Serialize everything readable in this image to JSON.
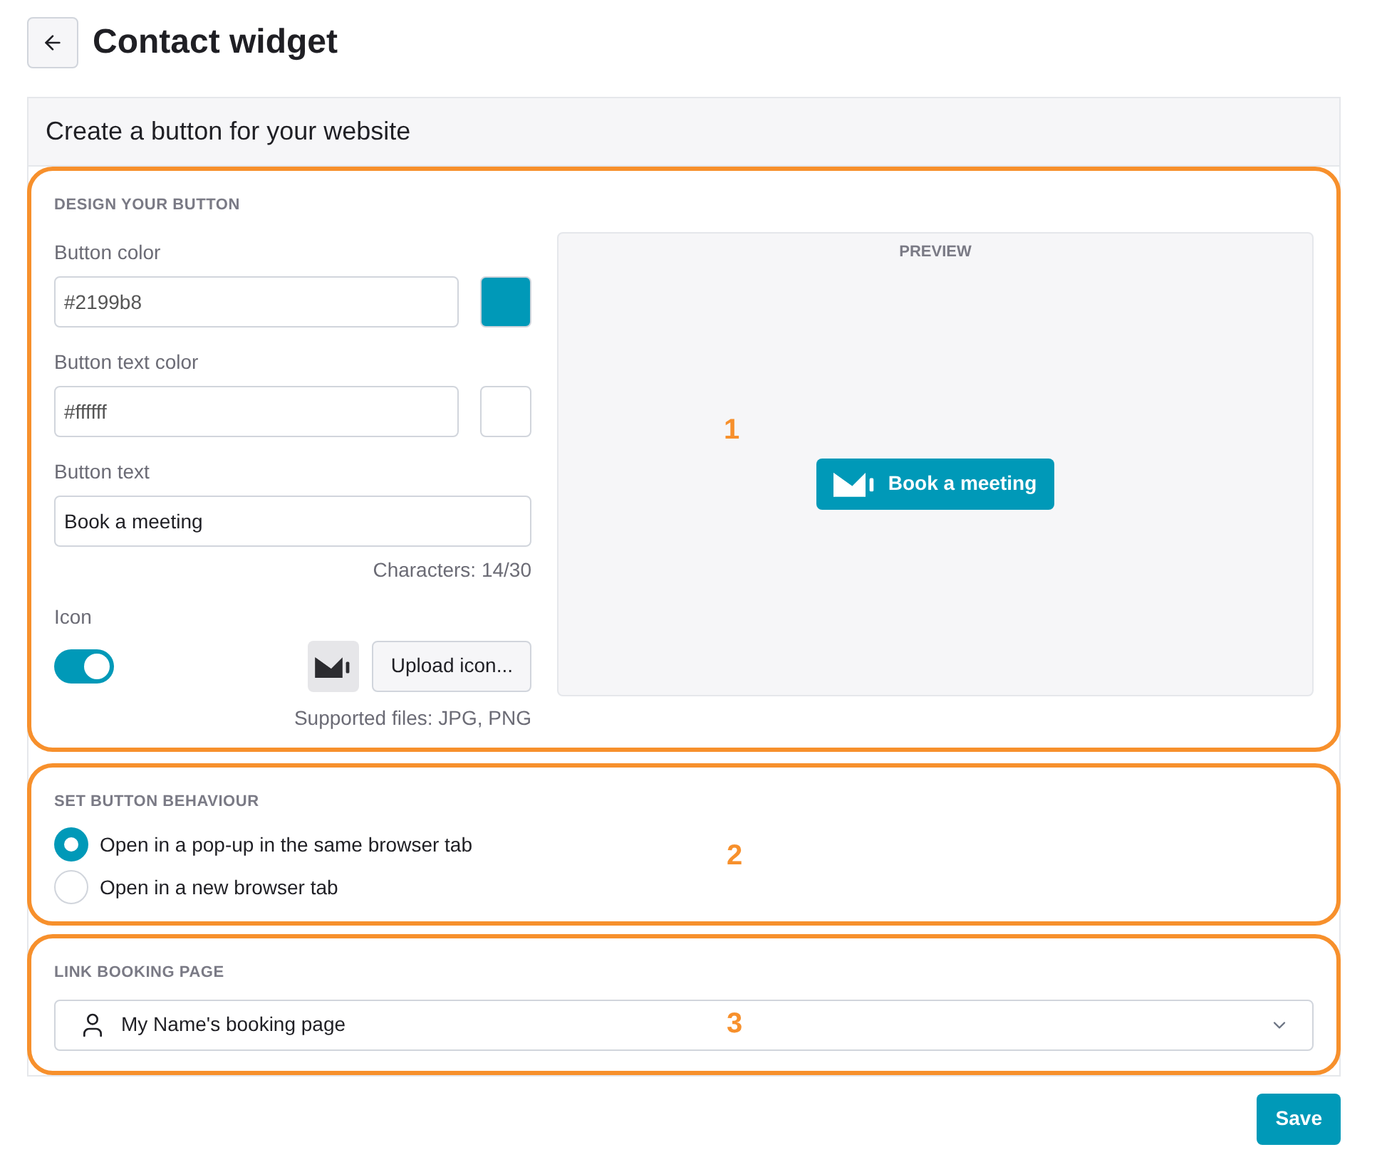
{
  "page": {
    "title": "Contact widget"
  },
  "card": {
    "title": "Create a button for your website"
  },
  "design": {
    "callout": "1",
    "heading": "DESIGN YOUR BUTTON",
    "fields": [
      {
        "kind": "color",
        "label": "Button color",
        "value": "#2199b8",
        "color": "#0099b8"
      },
      {
        "kind": "color",
        "label": "Button text color",
        "value": "#ffffff",
        "color": "#ffffff"
      },
      {
        "kind": "text",
        "label": "Button text",
        "value": "Book a meeting",
        "counter": "Characters: 14/30"
      }
    ],
    "icon": {
      "label": "Icon",
      "on": true,
      "upload": "Upload icon...",
      "note": "Supported files: JPG, PNG"
    },
    "preview": {
      "heading": "PREVIEW",
      "button": "Book a meeting"
    }
  },
  "behaviour": {
    "callout": "2",
    "heading": "SET BUTTON BEHAVIOUR",
    "options": [
      {
        "label": "Open in a pop-up in the same browser tab",
        "selected": true
      },
      {
        "label": "Open in a new browser tab",
        "selected": false
      }
    ]
  },
  "booking": {
    "callout": "3",
    "heading": "LINK BOOKING PAGE",
    "value": "My Name's booking page"
  },
  "save": "Save"
}
